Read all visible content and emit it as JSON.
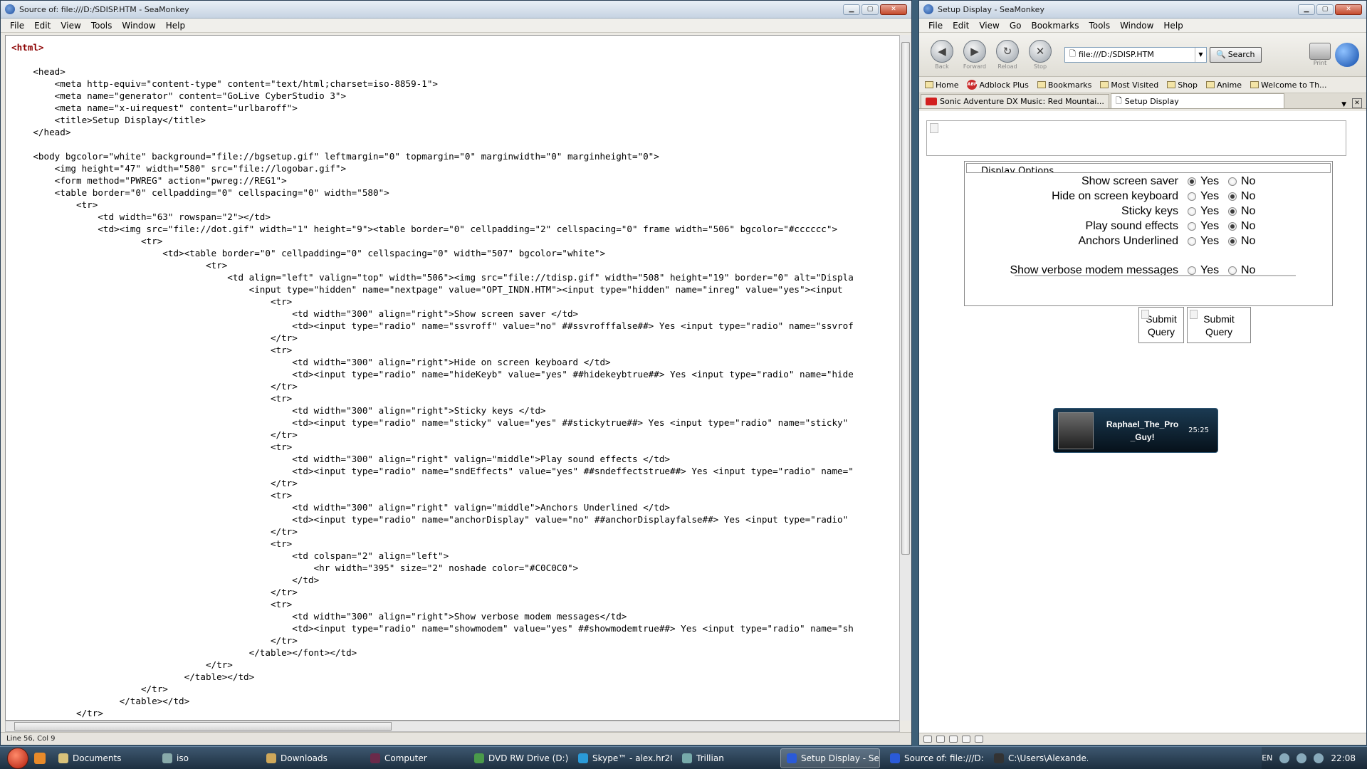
{
  "left_window": {
    "title": "Source of: file:///D:/SDISP.HTM - SeaMonkey",
    "menu": [
      "File",
      "Edit",
      "View",
      "Tools",
      "Window",
      "Help"
    ],
    "status": "Line 56, Col 9",
    "source_lines": [
      "<html>",
      "",
      "    <head>",
      "        <meta http-equiv=\"content-type\" content=\"text/html;charset=iso-8859-1\">",
      "        <meta name=\"generator\" content=\"GoLive CyberStudio 3\">",
      "        <meta name=\"x-uirequest\" content=\"urlbaroff\">",
      "        <title>Setup Display</title>",
      "    </head>",
      "",
      "    <body bgcolor=\"white\" background=\"file://bgsetup.gif\" leftmargin=\"0\" topmargin=\"0\" marginwidth=\"0\" marginheight=\"0\">",
      "        <img height=\"47\" width=\"580\" src=\"file://logobar.gif\">",
      "        <form method=\"PWREG\" action=\"pwreg://REG1\">",
      "        <table border=\"0\" cellpadding=\"0\" cellspacing=\"0\" width=\"580\">",
      "            <tr>",
      "                <td width=\"63\" rowspan=\"2\"></td>",
      "                <td><img src=\"file://dot.gif\" width=\"1\" height=\"9\"><table border=\"0\" cellpadding=\"2\" cellspacing=\"0\" frame width=\"506\" bgcolor=\"#cccccc\">",
      "                        <tr>",
      "                            <td><table border=\"0\" cellpadding=\"0\" cellspacing=\"0\" width=\"507\" bgcolor=\"white\">",
      "                                    <tr>",
      "                                        <td align=\"left\" valign=\"top\" width=\"506\"><img src=\"file://tdisp.gif\" width=\"508\" height=\"19\" border=\"0\" alt=\"Displa",
      "                                            <input type=\"hidden\" name=\"nextpage\" value=\"OPT_INDN.HTM\"><input type=\"hidden\" name=\"inreg\" value=\"yes\"><input",
      "                                                <tr>",
      "                                                    <td width=\"300\" align=\"right\">Show screen saver </td>",
      "                                                    <td><input type=\"radio\" name=\"ssvroff\" value=\"no\" ##ssvrofffalse##> Yes <input type=\"radio\" name=\"ssvrof",
      "                                                </tr>",
      "                                                <tr>",
      "                                                    <td width=\"300\" align=\"right\">Hide on screen keyboard </td>",
      "                                                    <td><input type=\"radio\" name=\"hideKeyb\" value=\"yes\" ##hidekeybtrue##> Yes <input type=\"radio\" name=\"hide",
      "                                                </tr>",
      "                                                <tr>",
      "                                                    <td width=\"300\" align=\"right\">Sticky keys </td>",
      "                                                    <td><input type=\"radio\" name=\"sticky\" value=\"yes\" ##stickytrue##> Yes <input type=\"radio\" name=\"sticky\"",
      "                                                </tr>",
      "                                                <tr>",
      "                                                    <td width=\"300\" align=\"right\" valign=\"middle\">Play sound effects </td>",
      "                                                    <td><input type=\"radio\" name=\"sndEffects\" value=\"yes\" ##sndeffectstrue##> Yes <input type=\"radio\" name=\"",
      "                                                </tr>",
      "                                                <tr>",
      "                                                    <td width=\"300\" align=\"right\" valign=\"middle\">Anchors Underlined </td>",
      "                                                    <td><input type=\"radio\" name=\"anchorDisplay\" value=\"no\" ##anchorDisplayfalse##> Yes <input type=\"radio\"",
      "                                                </tr>",
      "                                                <tr>",
      "                                                    <td colspan=\"2\" align=\"left\">",
      "                                                        <hr width=\"395\" size=\"2\" noshade color=\"#C0C0C0\">",
      "                                                    </td>",
      "                                                </tr>",
      "                                                <tr>",
      "                                                    <td width=\"300\" align=\"right\">Show verbose modem messages</td>",
      "                                                    <td><input type=\"radio\" name=\"showmodem\" value=\"yes\" ##showmodemtrue##> Yes <input type=\"radio\" name=\"sh",
      "                                                </tr>",
      "                                            </table></font></td>",
      "                                    </tr>",
      "                                </table></td>",
      "                        </tr>",
      "                    </table></td>",
      "            </tr>"
    ]
  },
  "right_window": {
    "title": "Setup Display - SeaMonkey",
    "menu": [
      "File",
      "Edit",
      "View",
      "Go",
      "Bookmarks",
      "Tools",
      "Window",
      "Help"
    ],
    "nav": {
      "back": "Back",
      "forward": "Forward",
      "reload": "Reload",
      "stop": "Stop",
      "print": "Print"
    },
    "url": "file:///D:/SDISP.HTM",
    "search_label": "Search",
    "bookmarks": [
      "Home",
      "Adblock Plus",
      "Bookmarks",
      "Most Visited",
      "Shop",
      "Anime",
      "Welcome to Th..."
    ],
    "tabs": [
      "Sonic Adventure DX Music: Red Mountai...",
      "Setup Display"
    ],
    "options_header": "Display Options",
    "options": [
      {
        "label": "Show screen saver",
        "selected": "yes"
      },
      {
        "label": "Hide on screen keyboard",
        "selected": "no"
      },
      {
        "label": "Sticky keys",
        "selected": "no"
      },
      {
        "label": "Play sound effects",
        "selected": "no"
      },
      {
        "label": "Anchors Underlined",
        "selected": "no"
      },
      {
        "label": "Show verbose modem messages",
        "selected": "none"
      }
    ],
    "yes_label": "Yes",
    "no_label": "No",
    "submit_label": "Submit Query",
    "trillian": {
      "name": "Raphael_The_Pro _Guy!",
      "time": "25:25"
    }
  },
  "taskbar": {
    "items": [
      "Documents",
      "iso",
      "Downloads",
      "Computer",
      "DVD RW Drive (D:)...",
      "Skype™ - alex.hr20...",
      "Trillian",
      "Setup Display - Se...",
      "Source of: file:///D:...",
      "C:\\Users\\Alexande..."
    ],
    "lang": "EN",
    "clock": "22:08"
  }
}
